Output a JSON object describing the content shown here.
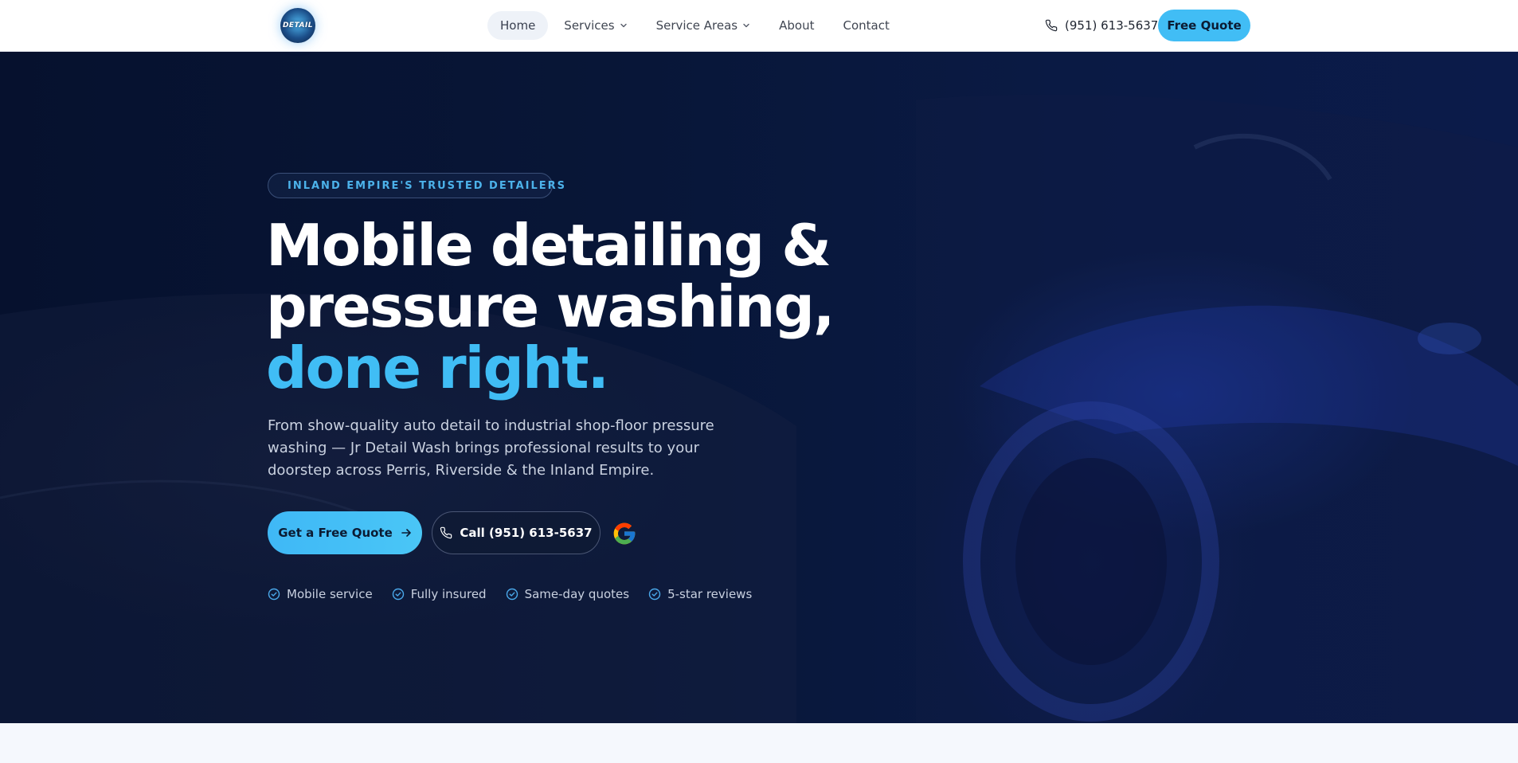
{
  "header": {
    "logo": {
      "text": "DETAIL",
      "alt": "Jr Detail Wash"
    },
    "nav": [
      {
        "label": "Home",
        "active": true,
        "dropdown": false
      },
      {
        "label": "Services",
        "active": false,
        "dropdown": true
      },
      {
        "label": "Service Areas",
        "active": false,
        "dropdown": true
      },
      {
        "label": "About",
        "active": false,
        "dropdown": false
      },
      {
        "label": "Contact",
        "active": false,
        "dropdown": false
      }
    ],
    "phone": "(951) 613-5637",
    "quote_label": "Free Quote"
  },
  "hero": {
    "badge": "INLAND EMPIRE'S TRUSTED DETAILERS",
    "headline_line1": "Mobile detailing &",
    "headline_line2": "pressure washing,",
    "headline_accent": "done right.",
    "subtext": "From show-quality auto detail to industrial shop-floor pressure washing — Jr Detail Wash brings professional results to your doorstep across Perris, Riverside & the Inland Empire.",
    "cta_primary": "Get a Free Quote",
    "cta_call": "Call (951) 613-5637",
    "features": [
      "Mobile service",
      "Fully insured",
      "Same-day quotes",
      "5-star reviews"
    ]
  },
  "icons": {
    "phone": "phone-icon",
    "arrow": "arrow-right-icon",
    "check": "check-circle-icon",
    "chevron": "chevron-down-icon",
    "google": "google-icon"
  },
  "colors": {
    "accent": "#40bdf5",
    "hero_bg": "#081637",
    "badge_text": "#4cb2ea",
    "header_bg": "#ffffff"
  }
}
